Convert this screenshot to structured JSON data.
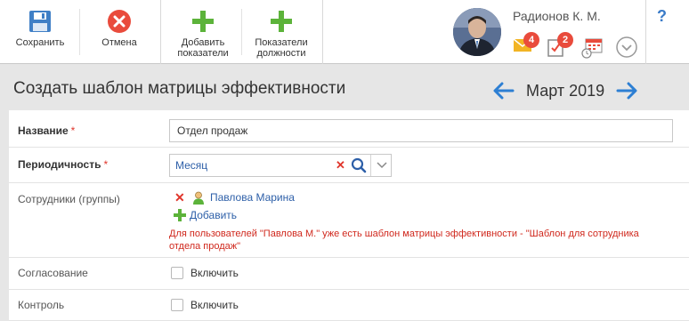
{
  "toolbar": {
    "save": "Сохранить",
    "cancel": "Отмена",
    "add_indicators": [
      "Добавить",
      "показатели"
    ],
    "position_indicators": [
      "Показатели",
      "должности"
    ]
  },
  "user": {
    "name": "Радионов К. М.",
    "mail_count": "4",
    "tasks_count": "2"
  },
  "help": "?",
  "page": {
    "title": "Создать шаблон матрицы эффективности",
    "period": "Март 2019"
  },
  "form": {
    "name": {
      "label": "Название",
      "required": "*",
      "value": "Отдел продаж"
    },
    "periodicity": {
      "label": "Периодичность",
      "required": "*",
      "value": "Месяц"
    },
    "employees": {
      "label": "Сотрудники (группы)",
      "items": [
        "Павлова Марина"
      ],
      "add_label": "Добавить",
      "warning": "Для пользователей \"Павлова М.\" уже есть шаблон матрицы эффективности - \"Шаблон для сотрудника отдела продаж\""
    },
    "approval": {
      "label": "Согласование",
      "checkbox_label": "Включить"
    },
    "control": {
      "label": "Контроль",
      "checkbox_label": "Включить"
    }
  },
  "colors": {
    "accent_blue": "#2d7fd3",
    "green": "#5cb33a",
    "red": "#e94b3c",
    "save_blue": "#3f7fc6"
  }
}
